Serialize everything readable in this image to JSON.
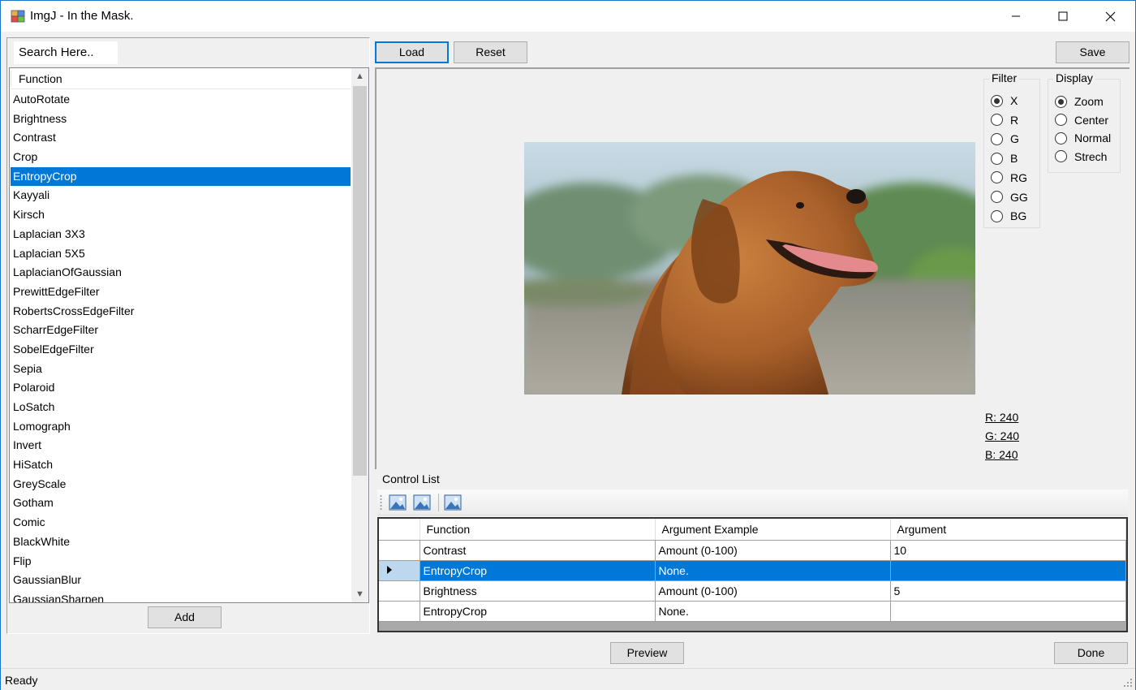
{
  "window": {
    "title": "ImgJ - In the Mask."
  },
  "search": {
    "text": "Search Here.."
  },
  "function_list": {
    "header": "Function",
    "items": [
      "AutoRotate",
      "Brightness",
      "Contrast",
      "Crop",
      "EntropyCrop",
      "Kayyali",
      "Kirsch",
      "Laplacian 3X3",
      "Laplacian 5X5",
      "LaplacianOfGaussian",
      "PrewittEdgeFilter",
      "RobertsCrossEdgeFilter",
      "ScharrEdgeFilter",
      "SobelEdgeFilter",
      "Sepia",
      "Polaroid",
      "LoSatch",
      "Lomograph",
      "Invert",
      "HiSatch",
      "GreyScale",
      "Gotham",
      "Comic",
      "BlackWhite",
      "Flip",
      "GaussianBlur",
      "GaussianSharpen"
    ],
    "selected": "EntropyCrop"
  },
  "buttons": {
    "add": "Add",
    "load": "Load",
    "reset": "Reset",
    "save": "Save",
    "preview": "Preview",
    "done": "Done"
  },
  "filter": {
    "title": "Filter",
    "options": [
      "X",
      "R",
      "G",
      "B",
      "RG",
      "GG",
      "BG"
    ],
    "selected": "X"
  },
  "display": {
    "title": "Display",
    "options": [
      "Zoom",
      "Center",
      "Normal",
      "Strech"
    ],
    "selected": "Zoom"
  },
  "pixel_readout": {
    "r": "R: 240",
    "g": "G: 240",
    "b": "B: 240"
  },
  "control_list": {
    "title": "Control List",
    "toolbar_icons": [
      "image-add-icon",
      "image-edit-icon",
      "image-remove-icon"
    ],
    "columns": [
      "Function",
      "Argument Example",
      "Argument"
    ],
    "rows": [
      {
        "function": "Contrast",
        "example": "Amount (0-100)",
        "argument": "10",
        "selected": false
      },
      {
        "function": "EntropyCrop",
        "example": "None.",
        "argument": "",
        "selected": true
      },
      {
        "function": "Brightness",
        "example": "Amount (0-100)",
        "argument": "5",
        "selected": false
      },
      {
        "function": "EntropyCrop",
        "example": "None.",
        "argument": "",
        "selected": false
      }
    ]
  },
  "status": {
    "text": "Ready"
  },
  "colors": {
    "accent": "#0078d7",
    "window_bg": "#f0f0f0"
  }
}
